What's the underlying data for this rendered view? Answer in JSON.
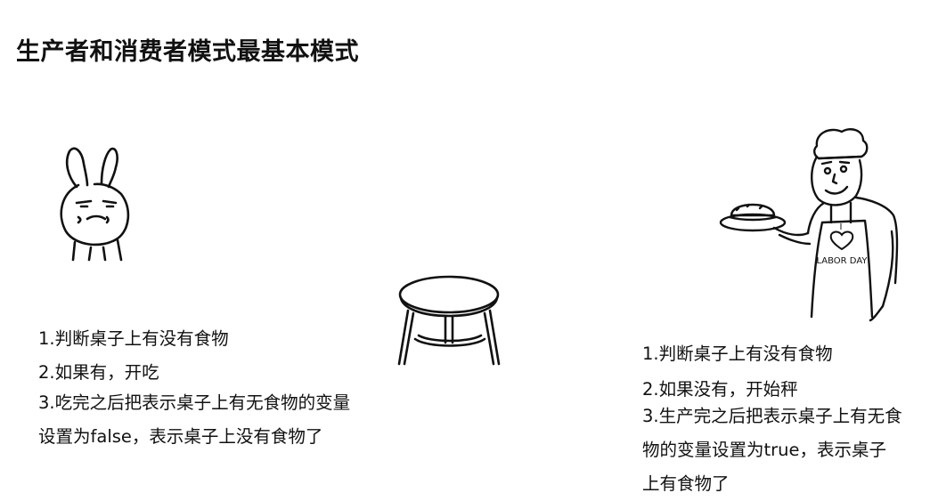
{
  "title": "生产者和消费者模式最基本模式",
  "consumer": {
    "steps": [
      "1.判断桌子上有没有食物",
      "2.如果有，开吃",
      "3.吃完之后把表示桌子上有无食物的变量设置为false，表示桌子上没有食物了"
    ]
  },
  "producer": {
    "steps": [
      "1.判断桌子上有没有食物",
      "2.如果没有，开始秤",
      "3.生产完之后把表示桌子上有无食物的变量设置为true，表示桌子上有食物了"
    ],
    "apron_text": {
      "line1": "I",
      "line2": "LABOR DAY"
    }
  },
  "icons": {
    "consumer": "rabbit-icon",
    "table": "table-icon",
    "producer": "chef-icon"
  }
}
